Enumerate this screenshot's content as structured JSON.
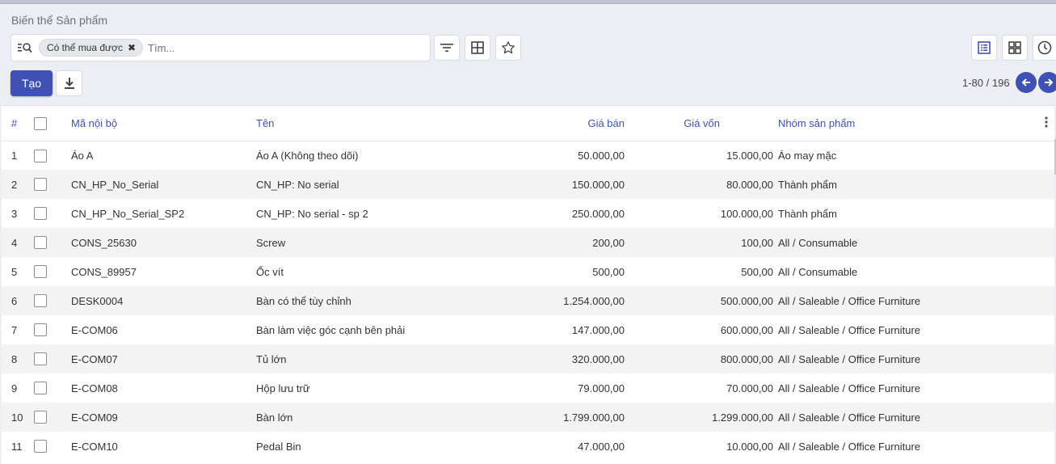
{
  "breadcrumb": "Biến thể Sản phẩm",
  "search": {
    "facet_label": "Có thể mua được",
    "facet_remove": "✖",
    "placeholder": "Tìm..."
  },
  "toolbar": {
    "create_label": "Tạo"
  },
  "pager": {
    "text": "1-80 / 196"
  },
  "table": {
    "columns": [
      "#",
      "Mã nội bộ",
      "Tên",
      "Giá bán",
      "Giá vốn",
      "Nhóm sản phẩm"
    ],
    "rows": [
      {
        "n": "1",
        "code": "Áo A",
        "name": "Áo A (Không theo dõi)",
        "price": "50.000,00",
        "cost": "15.000,00",
        "category": "Áo may mặc"
      },
      {
        "n": "2",
        "code": "CN_HP_No_Serial",
        "name": "CN_HP: No serial",
        "price": "150.000,00",
        "cost": "80.000,00",
        "category": "Thành phẩm"
      },
      {
        "n": "3",
        "code": "CN_HP_No_Serial_SP2",
        "name": "CN_HP: No serial - sp 2",
        "price": "250.000,00",
        "cost": "100.000,00",
        "category": "Thành phẩm"
      },
      {
        "n": "4",
        "code": "CONS_25630",
        "name": "Screw",
        "price": "200,00",
        "cost": "100,00",
        "category": "All / Consumable"
      },
      {
        "n": "5",
        "code": "CONS_89957",
        "name": "Ốc vít",
        "price": "500,00",
        "cost": "500,00",
        "category": "All / Consumable"
      },
      {
        "n": "6",
        "code": "DESK0004",
        "name": "Bàn có thể tùy chỉnh",
        "price": "1.254.000,00",
        "cost": "500.000,00",
        "category": "All / Saleable / Office Furniture"
      },
      {
        "n": "7",
        "code": "E-COM06",
        "name": "Bàn làm việc góc cạnh bên phải",
        "price": "147.000,00",
        "cost": "600.000,00",
        "category": "All / Saleable / Office Furniture"
      },
      {
        "n": "8",
        "code": "E-COM07",
        "name": "Tủ lớn",
        "price": "320.000,00",
        "cost": "800.000,00",
        "category": "All / Saleable / Office Furniture"
      },
      {
        "n": "9",
        "code": "E-COM08",
        "name": "Hộp lưu trữ",
        "price": "79.000,00",
        "cost": "70.000,00",
        "category": "All / Saleable / Office Furniture"
      },
      {
        "n": "10",
        "code": "E-COM09",
        "name": "Bàn lớn",
        "price": "1.799.000,00",
        "cost": "1.299.000,00",
        "category": "All / Saleable / Office Furniture"
      },
      {
        "n": "11",
        "code": "E-COM10",
        "name": "Pedal Bin",
        "price": "47.000,00",
        "cost": "10.000,00",
        "category": "All / Saleable / Office Furniture"
      }
    ]
  },
  "icons": {
    "search": "search-options-icon",
    "filter": "filter-icon",
    "group": "group-by-icon",
    "favorite": "star-icon",
    "download": "download-icon",
    "list_view": "list-view-icon",
    "kanban_view": "kanban-view-icon",
    "activity_view": "clock-icon",
    "prev": "arrow-left-icon",
    "next": "arrow-right-icon",
    "options": "kebab-icon"
  },
  "colors": {
    "primary": "#3f51b5",
    "header_text": "#3f51b5",
    "row_alt": "#f3f3f3"
  }
}
